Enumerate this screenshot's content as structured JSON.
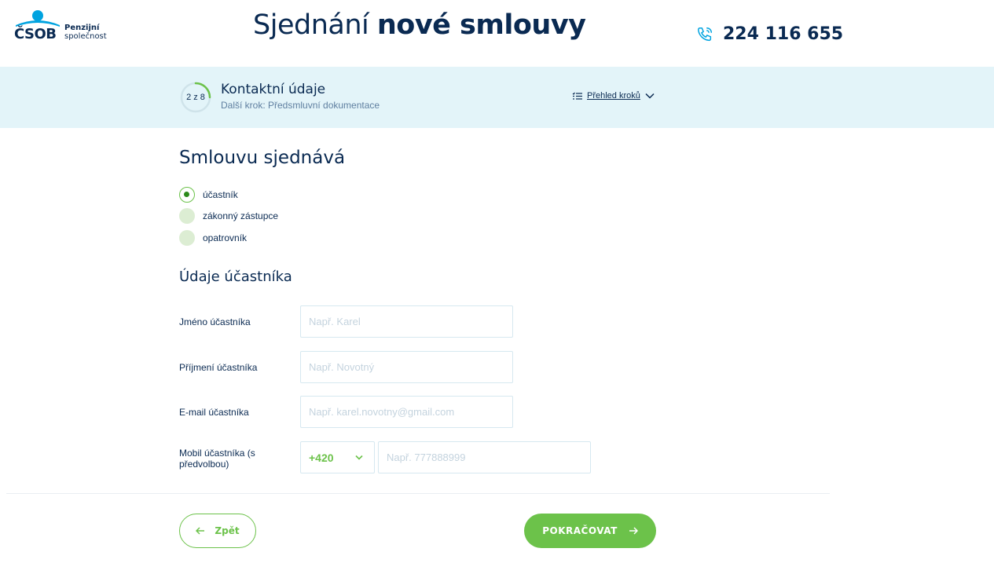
{
  "header": {
    "logo_brand": "ČSOB",
    "logo_sub_line1": "Penzijní",
    "logo_sub_line2": "společnost",
    "title_regular": "Sjednání ",
    "title_bold": "nové smlouvy",
    "phone_number": "224 116 655",
    "phone_icon": "phone-icon"
  },
  "stepbar": {
    "progress_label": "2 z 8",
    "progress_fraction": 0.25,
    "step_title": "Kontaktní údaje",
    "next_step": "Další krok: Předsmluvní dokumentace",
    "overview_label": "Přehled kroků",
    "overview_icon": "checklist-icon"
  },
  "form": {
    "section_title": "Smlouvu sjednává",
    "radios": [
      {
        "label": "účastník",
        "selected": true
      },
      {
        "label": "zákonný zástupce",
        "selected": false
      },
      {
        "label": "opatrovník",
        "selected": false
      }
    ],
    "details_title": "Údaje účastníka",
    "first_name": {
      "label": "Jméno účastníka",
      "placeholder": "Např. Karel",
      "value": ""
    },
    "last_name": {
      "label": "Příjmení účastníka",
      "placeholder": "Např. Novotný",
      "value": ""
    },
    "email": {
      "label": "E-mail účastníka",
      "placeholder": "Např. karel.novotny@gmail.com",
      "value": ""
    },
    "mobile": {
      "label": "Mobil účastníka (s předvolbou)",
      "prefix": "+420",
      "placeholder": "Např. 777888999",
      "value": ""
    }
  },
  "actions": {
    "back_label": "Zpět",
    "next_label": "POKRAČOVAT"
  },
  "colors": {
    "primary": "#0a2a52",
    "accent": "#6cc24a",
    "stepbar_bg": "#e3f4f9",
    "logo_blue": "#00a3e0"
  }
}
